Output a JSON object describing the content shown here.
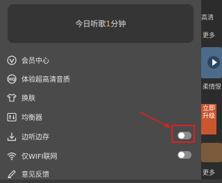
{
  "background_app": {
    "texts": [
      "高清",
      "更多",
      "柔情恨",
      "更多"
    ],
    "promo_badge": "立即升级"
  },
  "listen_card": {
    "prefix": "今日听歌",
    "minutes": "1",
    "suffix": "分钟"
  },
  "menu": {
    "items": [
      {
        "label": "会员中心",
        "icon": "vip-icon"
      },
      {
        "label": "体验超高清音质",
        "icon": "hq-icon"
      },
      {
        "label": "换肤",
        "icon": "shirt-icon"
      },
      {
        "label": "均衡器",
        "icon": "equalizer-icon"
      },
      {
        "label": "边听边存",
        "icon": "download-icon",
        "toggle": "off"
      },
      {
        "label": "仅WIFI联网",
        "icon": "wifi-icon",
        "toggle": "off"
      },
      {
        "label": "意见反馈",
        "icon": "pen-icon"
      }
    ]
  },
  "annotation": {
    "color": "#e01e1e"
  }
}
